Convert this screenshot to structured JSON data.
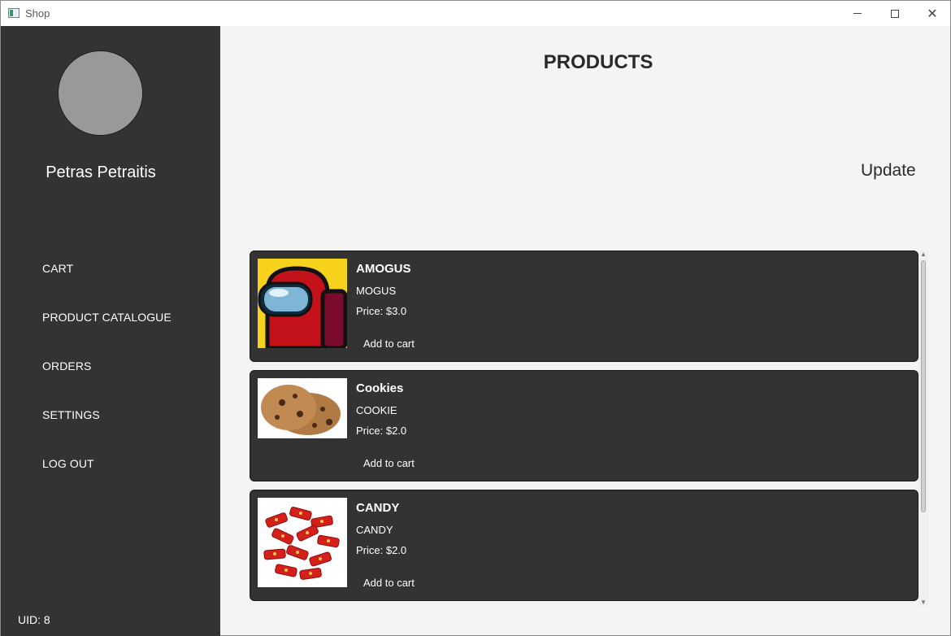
{
  "window": {
    "title": "Shop"
  },
  "sidebar": {
    "user_name": "Petras Petraitis",
    "items": [
      {
        "label": "CART"
      },
      {
        "label": "PRODUCT CATALOGUE"
      },
      {
        "label": "ORDERS"
      },
      {
        "label": "SETTINGS"
      },
      {
        "label": "LOG OUT"
      }
    ],
    "uid": "UID: 8"
  },
  "main": {
    "title": "PRODUCTS",
    "update_label": "Update",
    "products": [
      {
        "name": "AMOGUS",
        "code": "MOGUS",
        "price": "Price: $3.0",
        "add_label": "Add to cart",
        "image": "red-crewmate-image"
      },
      {
        "name": "Cookies",
        "code": "COOKIE",
        "price": "Price: $2.0",
        "add_label": "Add to cart",
        "image": "cookies-image"
      },
      {
        "name": "CANDY",
        "code": "CANDY",
        "price": "Price: $2.0",
        "add_label": "Add to cart",
        "image": "candy-image"
      }
    ]
  },
  "colors": {
    "sidebar_bg": "#333333",
    "card_bg": "#333333",
    "page_bg": "#f4f4f4",
    "avatar": "#999999"
  }
}
